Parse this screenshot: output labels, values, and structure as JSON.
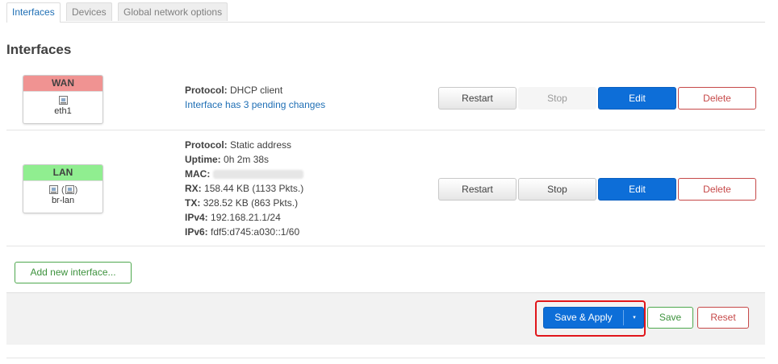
{
  "tabs": [
    "Interfaces",
    "Devices",
    "Global network options"
  ],
  "section_title": "Interfaces",
  "interfaces": [
    {
      "name": "WAN",
      "device": "eth1",
      "header_color": "#f09392",
      "protocol_label": "Protocol:",
      "protocol": "DHCP client",
      "pending": "Interface has 3 pending changes",
      "buttons": [
        "Restart",
        "Stop",
        "Edit",
        "Delete"
      ]
    },
    {
      "name": "LAN",
      "device": "br-lan",
      "header_color": "#90ee90",
      "protocol_label": "Protocol:",
      "protocol": "Static address",
      "uptime_label": "Uptime:",
      "uptime": "0h 2m 38s",
      "mac_label": "MAC:",
      "rx_label": "RX:",
      "rx": "158.44 KB (1133 Pkts.)",
      "tx_label": "TX:",
      "tx": "328.52 KB (863 Pkts.)",
      "ipv4_label": "IPv4:",
      "ipv4": "192.168.21.1/24",
      "ipv6_label": "IPv6:",
      "ipv6": "fdf5:d745:a030::1/60",
      "buttons": [
        "Restart",
        "Stop",
        "Edit",
        "Delete"
      ]
    }
  ],
  "add_interface": "Add new interface...",
  "footer": {
    "save_apply": "Save & Apply",
    "caret": "▾",
    "save": "Save",
    "reset": "Reset"
  },
  "colors": {
    "primary": "#0d6ed8",
    "danger": "#c64848",
    "success": "#3d923d",
    "link": "#1f6fb5",
    "highlight": "#e0161b"
  }
}
